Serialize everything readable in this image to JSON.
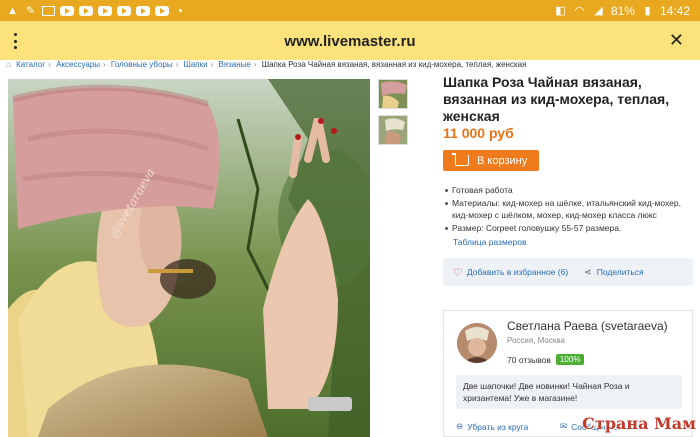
{
  "status_bar": {
    "battery": "81%",
    "time": "14:42"
  },
  "browser": {
    "url": "www.livemaster.ru"
  },
  "breadcrumbs": [
    "Каталог",
    "Аксессуары",
    "Головные уборы",
    "Шапки",
    "Вязаные",
    "Шапка Роза Чайная вязаная, вязанная из кид-мохера, теплая, женская"
  ],
  "product": {
    "title": "Шапка Роза Чайная вязаная, вязанная из кид-мохера, теплая, женская",
    "price": "11 000 руб",
    "cart_label": "В корзину",
    "photo_watermark": "@svetaraeva",
    "details": [
      "Готовая работа",
      "Материалы: кид-мохер на шёлке, итальянский кид-мохер, кид-мохер с шёлком, мохер, кид-мохер класса люкс",
      "Размер: Corpeet головушку 55-57 размера."
    ],
    "sizes_link": "Таблица размеров",
    "favorite_label": "Добавить в избранное (6)",
    "share_label": "Поделиться"
  },
  "seller": {
    "name": "Светлана Раева (svetaraeva)",
    "location": "Россия, Москва",
    "reviews": "70 отзывов",
    "rating": "100%",
    "message": "Две шапочки! Две новинки! Чайная Роза и хризантема! Уже в магазине!",
    "remove_label": "Убрать из круга",
    "message_label": "Сообщение"
  },
  "watermark": "Страна Мам",
  "colors": {
    "status_bar": "#e8a81f",
    "url_bar": "#fbe27b",
    "accent": "#f07b1c",
    "link": "#2a6db5"
  }
}
